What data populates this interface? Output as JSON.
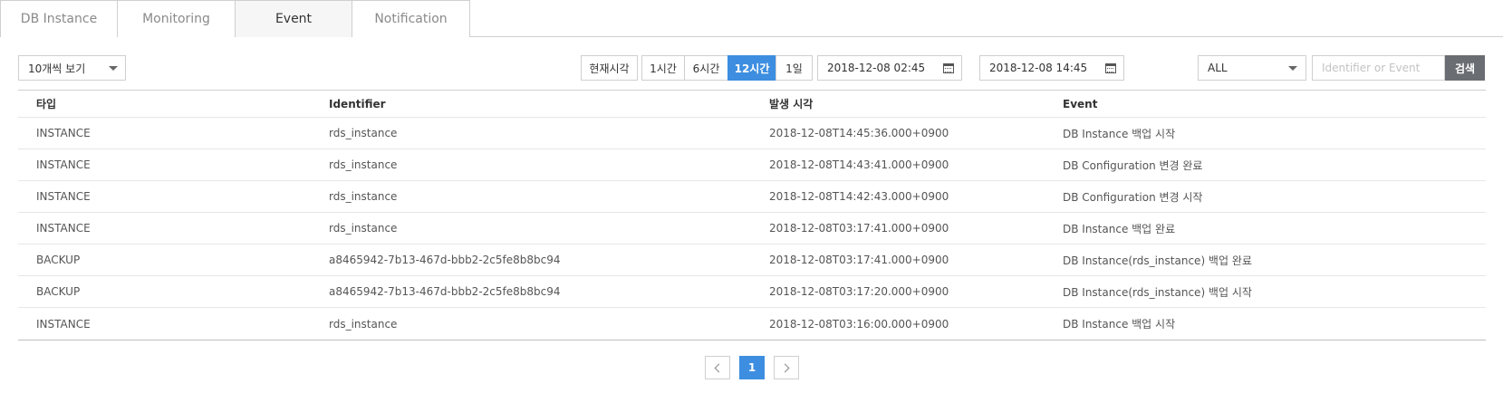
{
  "tabs": [
    {
      "label": "DB Instance"
    },
    {
      "label": "Monitoring"
    },
    {
      "label": "Event"
    },
    {
      "label": "Notification"
    }
  ],
  "active_tab": "Event",
  "toolbar": {
    "page_size": "10개씩 보기",
    "now_label": "현재시각",
    "ranges": [
      "1시간",
      "6시간",
      "12시간",
      "1일"
    ],
    "selected_range": "12시간",
    "date_from": "2018-12-08 02:45",
    "date_to": "2018-12-08 14:45",
    "range_separator": "~",
    "type_filter": "ALL",
    "search_placeholder": "Identifier or Event",
    "search_label": "검색"
  },
  "table": {
    "headers": [
      "타입",
      "Identifier",
      "발생 시각",
      "Event"
    ],
    "rows": [
      [
        "INSTANCE",
        "rds_instance",
        "2018-12-08T14:45:36.000+0900",
        "DB Instance 백업 시작"
      ],
      [
        "INSTANCE",
        "rds_instance",
        "2018-12-08T14:43:41.000+0900",
        "DB Configuration 변경 완료"
      ],
      [
        "INSTANCE",
        "rds_instance",
        "2018-12-08T14:42:43.000+0900",
        "DB Configuration 변경 시작"
      ],
      [
        "INSTANCE",
        "rds_instance",
        "2018-12-08T03:17:41.000+0900",
        "DB Instance 백업 완료"
      ],
      [
        "BACKUP",
        "a8465942-7b13-467d-bbb2-2c5fe8b8bc94",
        "2018-12-08T03:17:41.000+0900",
        "DB Instance(rds_instance) 백업 완료"
      ],
      [
        "BACKUP",
        "a8465942-7b13-467d-bbb2-2c5fe8b8bc94",
        "2018-12-08T03:17:20.000+0900",
        "DB Instance(rds_instance) 백업 시작"
      ],
      [
        "INSTANCE",
        "rds_instance",
        "2018-12-08T03:16:00.000+0900",
        "DB Instance 백업 시작"
      ]
    ]
  },
  "pagination": {
    "current_page": "1",
    "prev_icon": "chevron-left-icon",
    "next_icon": "chevron-right-icon"
  },
  "colors": {
    "accent": "#3d8ee0",
    "search_button": "#6a6e73",
    "border": "#cfcfcf"
  }
}
